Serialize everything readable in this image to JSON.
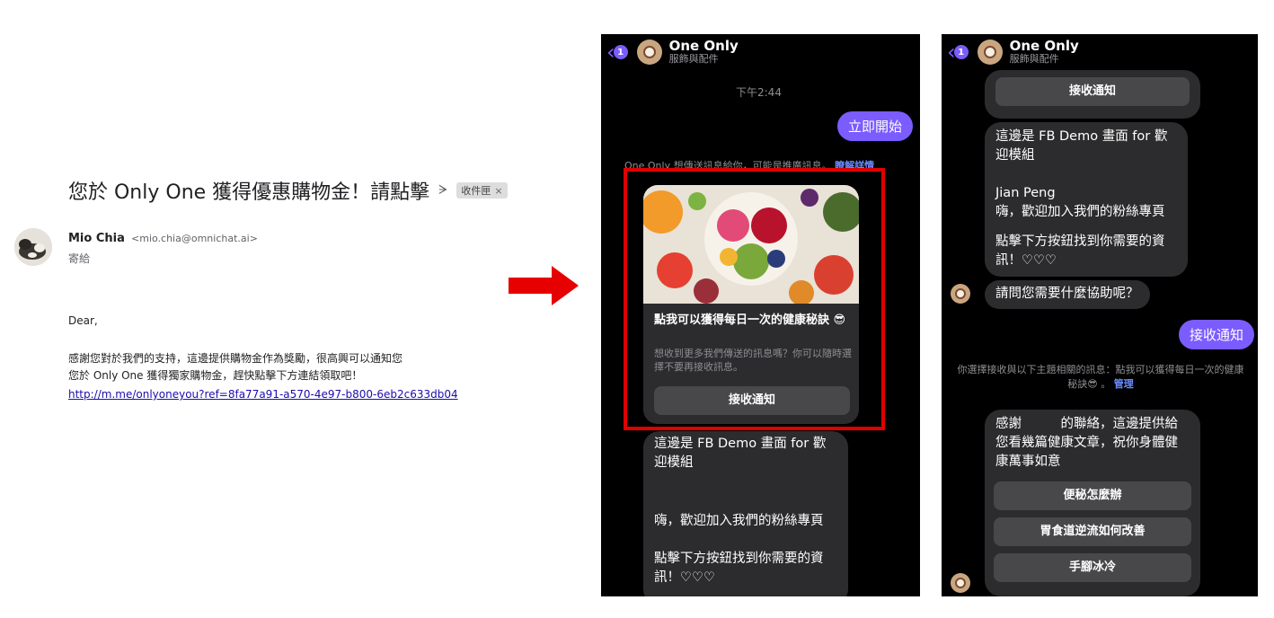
{
  "email": {
    "subject": "您於 Only One 獲得優惠購物金！請點擊",
    "label_chip": "收件匣",
    "label_close": "×",
    "importance_icon": "ᗒ",
    "sender_name": "Mio Chia",
    "sender_email": "<mio.chia@omnichat.ai>",
    "to_line": "寄給",
    "greeting": "Dear,",
    "body_line1": "感謝您對於我們的支持，這邊提供購物金作為獎勵，很高興可以通知您",
    "body_line2": "您於 Only One 獲得獨家購物金，趕快點擊下方連結領取吧！",
    "link": "http://m.me/onlyoneyou?ref=8fa77a91-a570-4e97-b800-6eb2c633db04"
  },
  "messenger1": {
    "back_badge": "1",
    "page_name": "One Only",
    "page_category": "服飾與配件",
    "time": "下午2:44",
    "out_message": "立即開始",
    "system_notice": "One Only 想傳送訊息給你，可能是推廣訊息。",
    "system_link": "瞭解詳情",
    "card_title": "點我可以獲得每日一次的健康秘訣 😎",
    "card_desc": "想收到更多我們傳送的訊息嗎？你可以隨時選擇不要再接收訊息。",
    "card_button": "接收通知",
    "reply_para1": "這邊是 FB Demo 畫面 for 歡迎模組",
    "reply_para2": "嗨，歡迎加入我們的粉絲專頁",
    "reply_para3": "點擊下方按鈕找到你需要的資訊！♡♡♡"
  },
  "messenger2": {
    "back_badge": "1",
    "page_name": "One Only",
    "page_category": "服飾與配件",
    "top_button": "接收通知",
    "welcome_para1": "這邊是 FB Demo 畫面 for 歡迎模組",
    "welcome_para2_line1": "Jian Peng",
    "welcome_para2_line2": "嗨，歡迎加入我們的粉絲專頁",
    "welcome_para3": "點擊下方按鈕找到你需要的資訊！♡♡♡",
    "question": "請問您需要什麼協助呢？",
    "out_message": "接收通知",
    "system_notice": "你選擇接收與以下主題相關的訊息：點我可以獲得每日一次的健康秘訣😎 。",
    "system_link": "管理",
    "thanks_msg": "感謝　　　的聯絡，這邊提供給您看幾篇健康文章，祝你身體健康萬事如意",
    "option1": "便秘怎麼辦",
    "option2": "胃食道逆流如何改善",
    "option3": "手腳冰冷"
  },
  "colors": {
    "messenger_accent": "#7b5cff",
    "highlight_red": "#e00000",
    "arrow_red": "#e60000",
    "link_blue": "#1a0dab"
  }
}
